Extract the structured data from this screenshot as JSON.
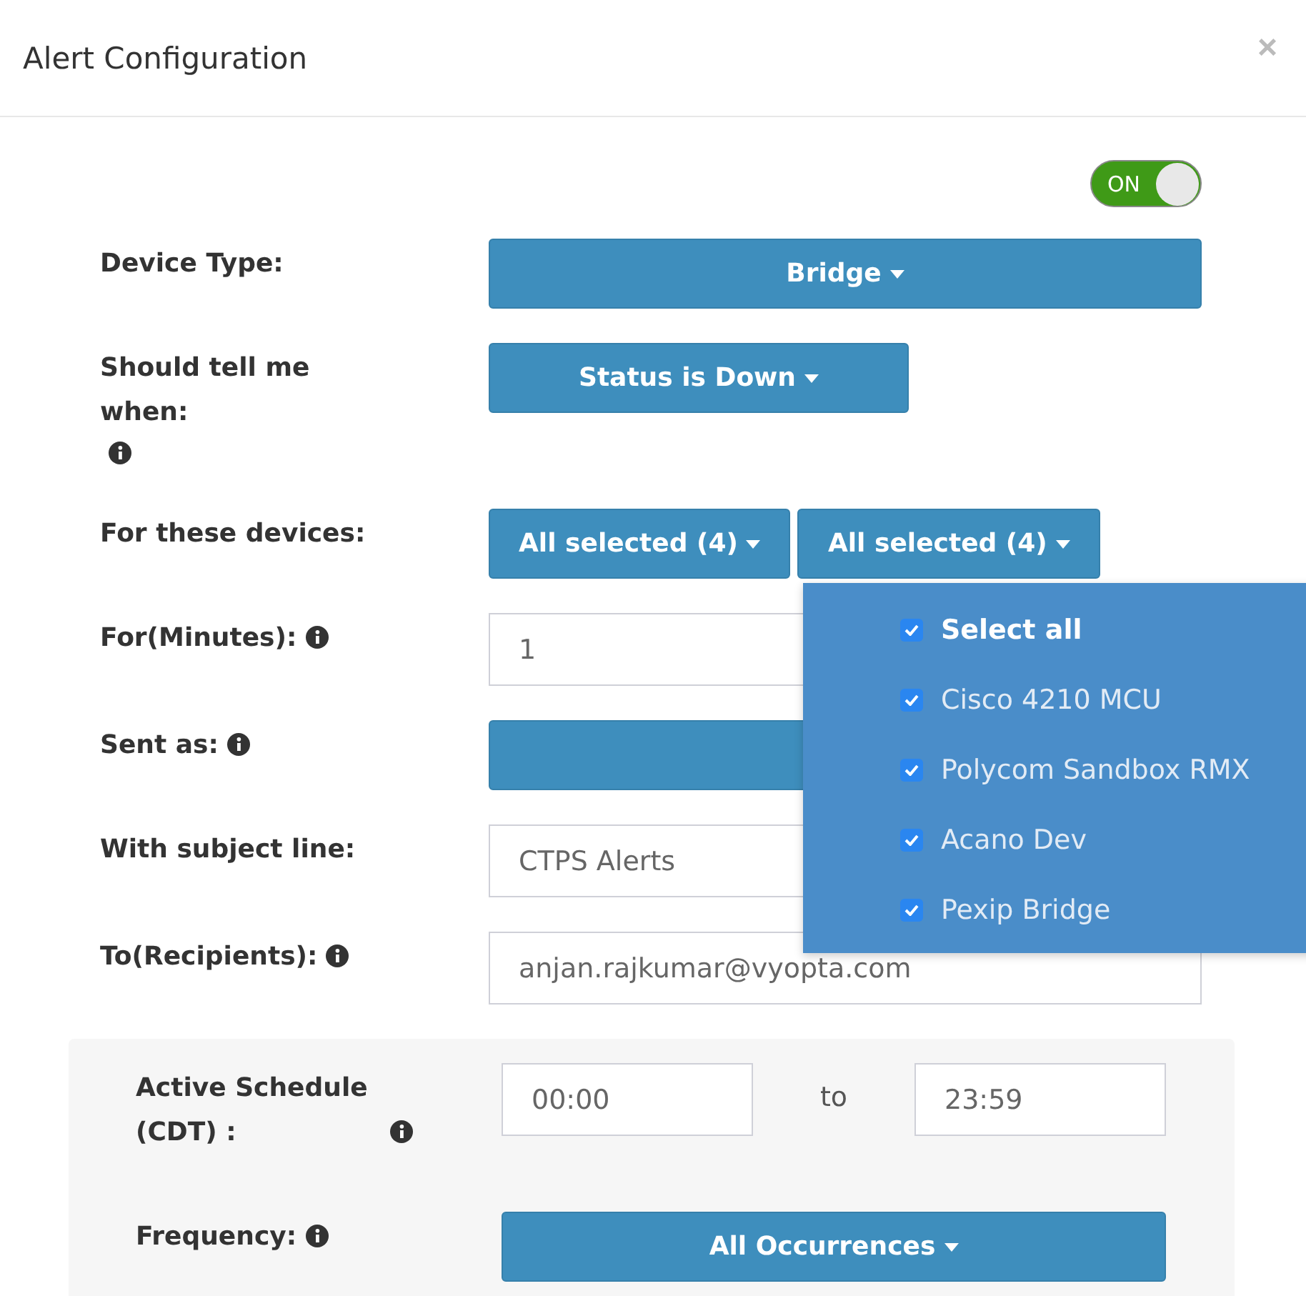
{
  "dialog": {
    "title": "Alert Configuration",
    "close": "×"
  },
  "toggle": {
    "label": "ON",
    "on": true
  },
  "rows": [
    {
      "kind": "dropdown",
      "label": "Device Type:",
      "value": "Bridge",
      "info": false
    },
    {
      "kind": "dropdown_short",
      "label": "Should tell me when:",
      "value": "Status is Down",
      "info": true,
      "info_below": true
    },
    {
      "kind": "dual_dropdown",
      "label": "For these devices:",
      "values": [
        "All selected (4)",
        "All selected (4)"
      ],
      "info": false
    },
    {
      "kind": "input",
      "label": "For(Minutes):",
      "value": "1",
      "info": true
    },
    {
      "kind": "dropdown",
      "label": "Sent as:",
      "info": true
    },
    {
      "kind": "input",
      "label": "With subject line:",
      "value": "CTPS Alerts",
      "info": false
    },
    {
      "kind": "input",
      "label": "To(Recipients):",
      "value": "anjan.rajkumar@vyopta.com",
      "info": true
    }
  ],
  "menu": {
    "items": [
      {
        "kind": "select_all",
        "label": "Select all",
        "checked": true
      },
      {
        "kind": "option",
        "label": "Cisco 4210 MCU",
        "checked": true
      },
      {
        "kind": "option",
        "label": "Polycom Sandbox RMX",
        "checked": true
      },
      {
        "kind": "option",
        "label": "Acano Dev",
        "checked": true
      },
      {
        "kind": "option",
        "label": "Pexip Bridge",
        "checked": true
      }
    ]
  },
  "schedule": {
    "label": "Active Schedule (CDT) :",
    "from": "00:00",
    "separator": "to",
    "to": "23:59",
    "frequency_label": "Frequency:",
    "frequency": "All Occurrences"
  }
}
